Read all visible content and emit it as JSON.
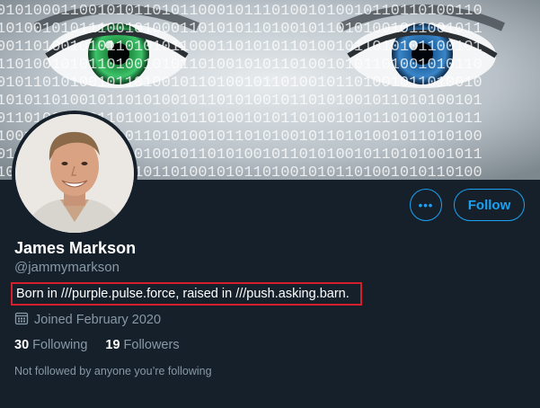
{
  "banner": {
    "digit_rows": [
      "01010001100101011010110001011101001010010110110100110",
      "10100101011100101000110101011010010110101001011001011",
      "00110100101011010101100011010101101001011010101100101",
      "11010010101101001010110100101011010010101101001010110",
      "01011010100101101001011010010110100101101001011010010",
      "10101101001011010100101101010010110101001011010100101",
      "01101001010110100101011010010101101001010110100101011",
      "10010110101001011010100101101010010110101001011010100",
      "01101010010110101001011010100101101010010110101001011",
      "10010101101001010110100101011010010101101001010110100"
    ]
  },
  "profile": {
    "name": "James Markson",
    "handle": "@jammymarkson",
    "bio": "Born in ///purple.pulse.force, raised in ///push.asking.barn.",
    "joined": "Joined February 2020",
    "following_count": "30",
    "following_label": "Following",
    "followers_count": "19",
    "followers_label": "Followers",
    "not_followed": "Not followed by anyone you’re following"
  },
  "actions": {
    "more_label": "•••",
    "follow_label": "Follow"
  },
  "colors": {
    "background": "#15202b",
    "accent": "#1da1f2",
    "muted_text": "#8899a6",
    "highlight_box": "#d4202a"
  },
  "icons": {
    "more": "more-icon",
    "calendar": "calendar-icon"
  }
}
